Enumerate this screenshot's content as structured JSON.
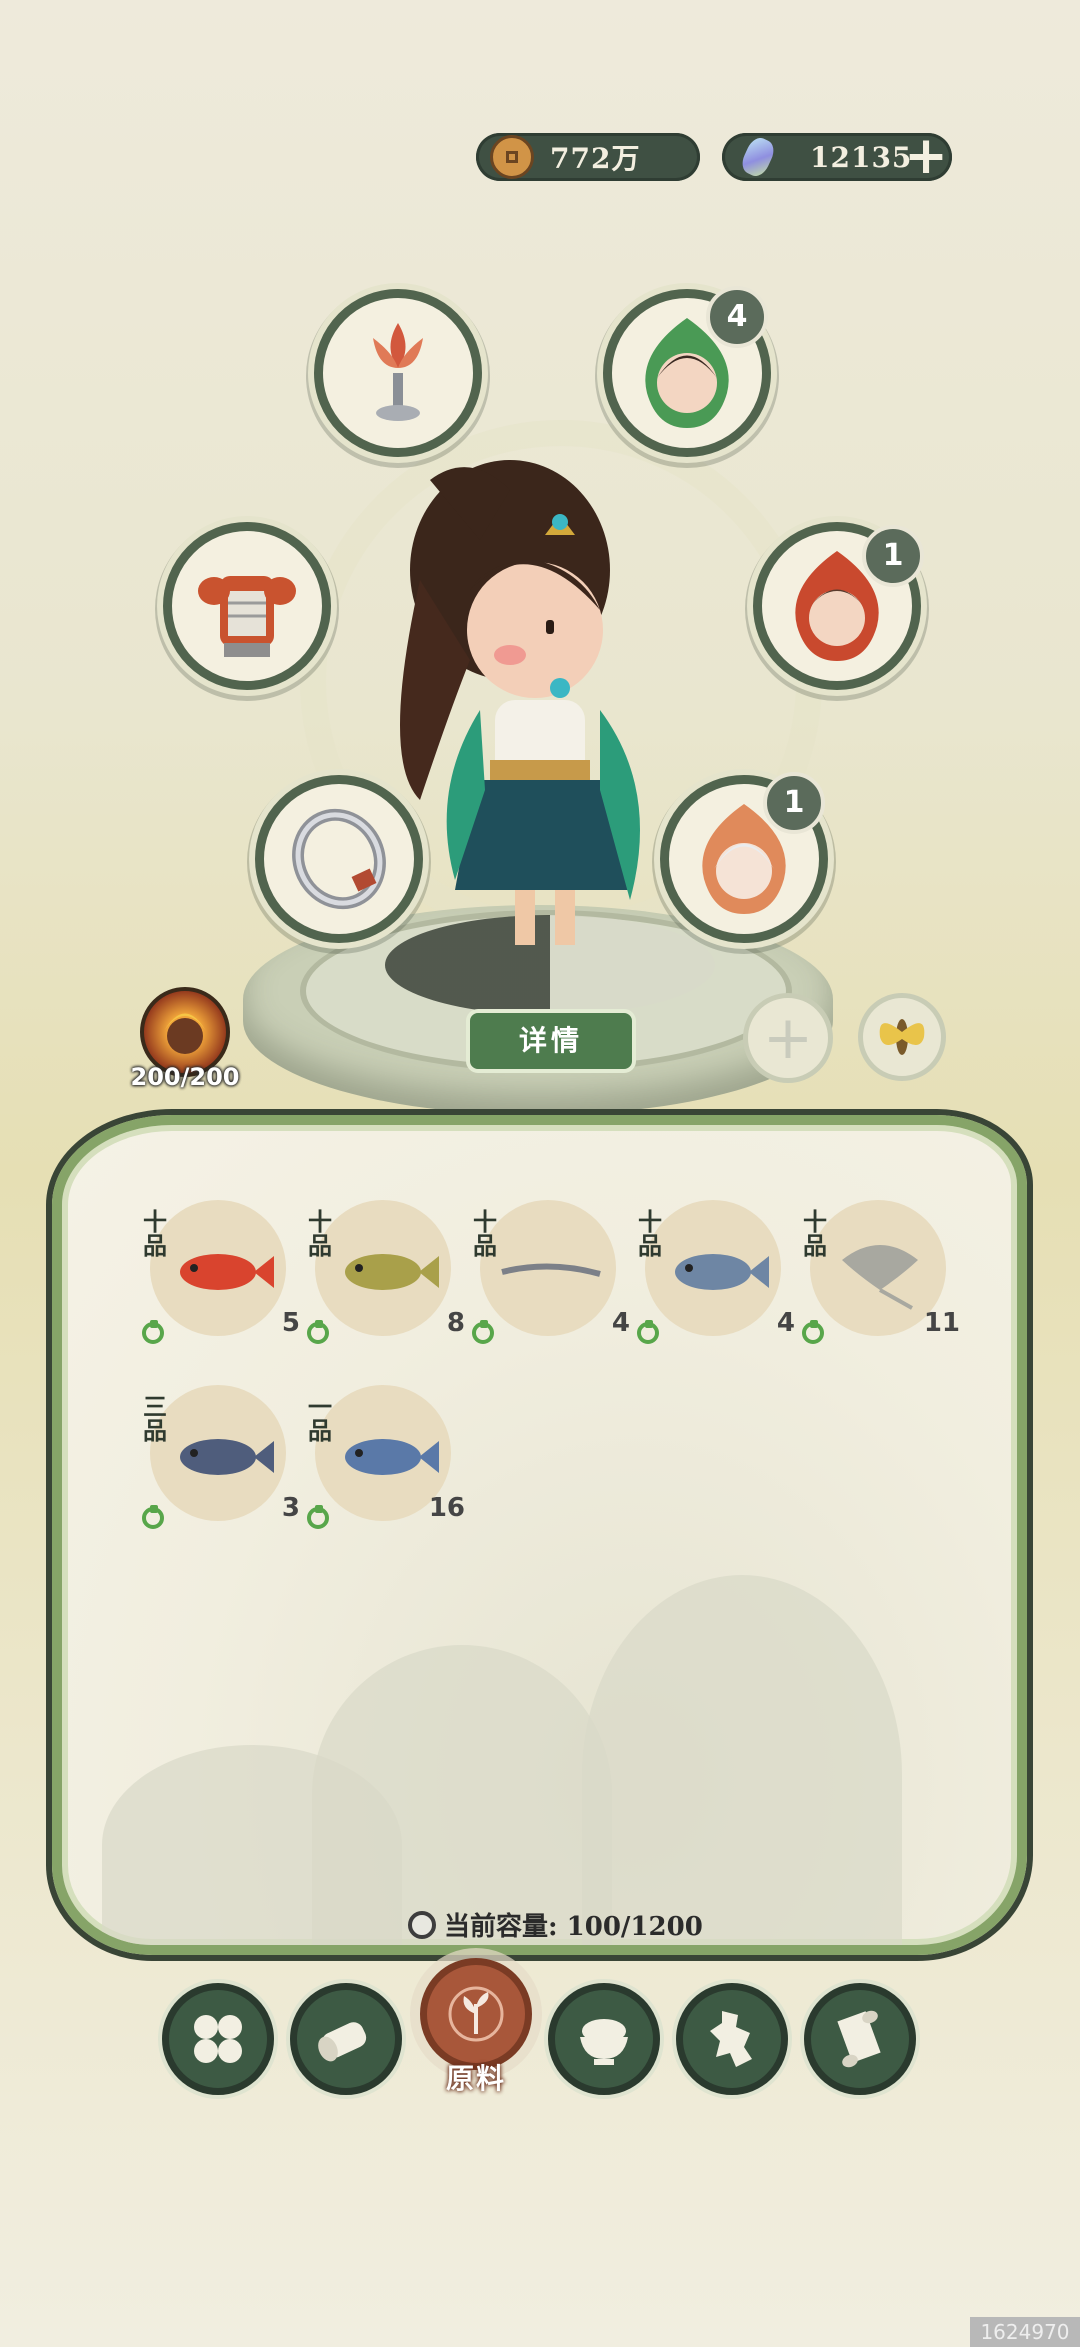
{
  "currency": {
    "coins": "772万",
    "gems": "12135"
  },
  "slots": {
    "lotus_lamp": {
      "icon": "lotus-lamp-icon"
    },
    "companion_top": {
      "icon": "companion-portrait-icon",
      "badge": "4"
    },
    "armor": {
      "icon": "armor-icon"
    },
    "companion_mid": {
      "icon": "companion-portrait-icon",
      "badge": "1"
    },
    "ring": {
      "icon": "ring-icon"
    },
    "companion_low": {
      "icon": "companion-portrait-icon",
      "badge": "1"
    }
  },
  "stamina": {
    "value": "200/200"
  },
  "details_label": "详情",
  "inventory": {
    "items": [
      {
        "grade": "十品",
        "name": "red-fish",
        "count": "5",
        "color": "#d9442e"
      },
      {
        "grade": "十品",
        "name": "yellow-fish",
        "count": "8",
        "color": "#a9a04a"
      },
      {
        "grade": "十品",
        "name": "eel",
        "count": "4",
        "color": "#7c8088"
      },
      {
        "grade": "十品",
        "name": "silver-fish",
        "count": "4",
        "color": "#6e86a4"
      },
      {
        "grade": "十品",
        "name": "stingray",
        "count": "11",
        "color": "#a8a8a0"
      },
      {
        "grade": "三品",
        "name": "anglerfish",
        "count": "3",
        "color": "#4f5d7c"
      },
      {
        "grade": "一品",
        "name": "blue-fish",
        "count": "16",
        "color": "#5a79a8"
      }
    ],
    "capacity": "当前容量: 100/1200"
  },
  "nav": {
    "active_label": "原料",
    "buttons": [
      "grid-icon",
      "log-icon",
      "herb-icon",
      "rice-bowl-icon",
      "map-icon",
      "scroll-icon"
    ]
  },
  "watermark": "1624970"
}
